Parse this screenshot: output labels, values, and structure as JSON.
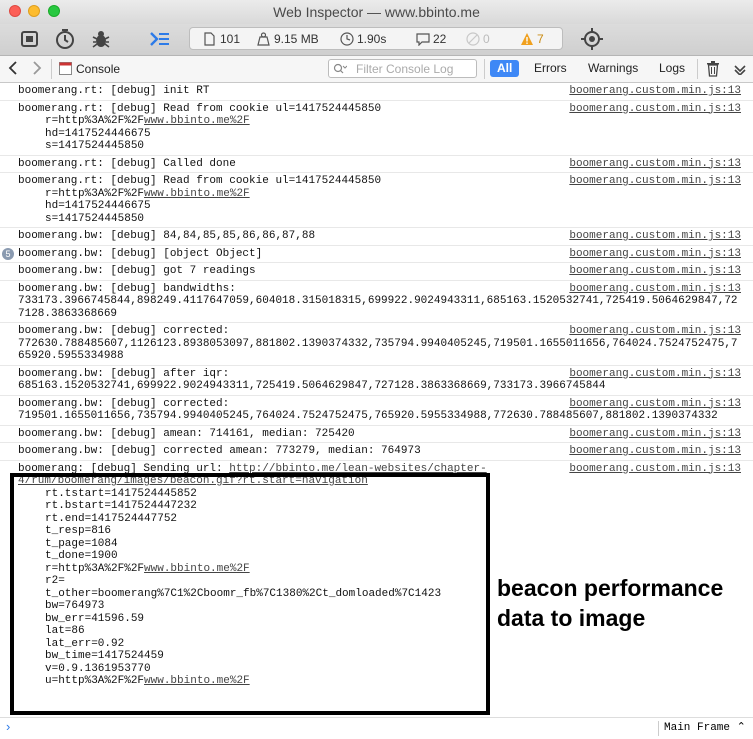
{
  "window": {
    "title": "Web Inspector — www.bbinto.me"
  },
  "stats": {
    "resources": "101",
    "size": "9.15 MB",
    "time": "1.90s",
    "logs": "22",
    "errors": "0",
    "warnings": "7"
  },
  "nav": {
    "tab": "Console",
    "search_placeholder": "Filter Console Log",
    "filters": {
      "all": "All",
      "errors": "Errors",
      "warnings": "Warnings",
      "logs": "Logs"
    }
  },
  "source": "boomerang.custom.min.js:13",
  "messages": [
    {
      "lines": [
        "boomerang.rt: [debug] init RT"
      ]
    },
    {
      "lines": [
        "boomerang.rt: [debug] Read from cookie ul=1417524445850"
      ],
      "extra": [
        "r=http%3A%2F%2F",
        "www.bbinto.me%2F",
        "hd=1417524446675",
        "s=1417524445850"
      ]
    },
    {
      "lines": [
        "boomerang.rt: [debug] Called done"
      ]
    },
    {
      "lines": [
        "boomerang.rt: [debug] Read from cookie ul=1417524445850"
      ],
      "extra": [
        "r=http%3A%2F%2F",
        "www.bbinto.me%2F",
        "hd=1417524446675",
        "s=1417524445850"
      ]
    },
    {
      "lines": [
        "boomerang.bw: [debug] 84,84,85,85,86,86,87,88"
      ]
    },
    {
      "badge": "5",
      "lines": [
        "boomerang.bw: [debug] [object Object]"
      ]
    },
    {
      "lines": [
        "boomerang.bw: [debug] got 7 readings"
      ]
    },
    {
      "lines": [
        "boomerang.bw: [debug] bandwidths:",
        "733173.3966745844,898249.4117647059,604018.315018315,699922.9024943311,685163.1520532741,725419.5064629847,72",
        "7128.3863368669"
      ]
    },
    {
      "lines": [
        "boomerang.bw: [debug] corrected:",
        "772630.788485607,1126123.8938053097,881802.1390374332,735794.9940405245,719501.1655011656,764024.7524752475,7",
        "65920.5955334988"
      ]
    },
    {
      "lines": [
        "boomerang.bw: [debug] after iqr:",
        "685163.1520532741,699922.9024943311,725419.5064629847,727128.3863368669,733173.3966745844"
      ]
    },
    {
      "lines": [
        "boomerang.bw: [debug] corrected:",
        "719501.1655011656,735794.9940405245,764024.7524752475,765920.5955334988,772630.788485607,881802.1390374332"
      ]
    },
    {
      "lines": [
        "boomerang.bw: [debug] amean: 714161, median: 725420"
      ]
    },
    {
      "lines": [
        "boomerang.bw: [debug] corrected amean: 773279, median: 764973"
      ]
    }
  ],
  "beacon": {
    "prefix": "boomerang: [debug] Sending url: ",
    "url1": "http://bbinto.me/lean-websites/chapter-",
    "url2": "4/rum/boomerang/images/beacon.gif?rt.start=navigation",
    "params": [
      "rt.tstart=1417524445852",
      "rt.bstart=1417524447232",
      "rt.end=1417524447752",
      "t_resp=816",
      "t_page=1084",
      "t_done=1900"
    ],
    "r_prefix": "r=http%3A%2F%2F",
    "r_link": "www.bbinto.me%2F",
    "params2": [
      "r2=",
      "t_other=boomerang%7C1%2Cboomr_fb%7C1380%2Ct_domloaded%7C1423",
      "bw=764973",
      "bw_err=41596.59",
      "lat=86",
      "lat_err=0.92",
      "bw_time=1417524459",
      "v=0.9.1361953770"
    ],
    "u_prefix": "u=http%3A%2F%2F",
    "u_link": "www.bbinto.me%2F"
  },
  "annotation": {
    "line1": "beacon performance",
    "line2": "data to image"
  },
  "bottom": {
    "frame": "Main Frame"
  },
  "colors": {
    "accent": "#3e88f6",
    "warning": "#f0a01e"
  }
}
